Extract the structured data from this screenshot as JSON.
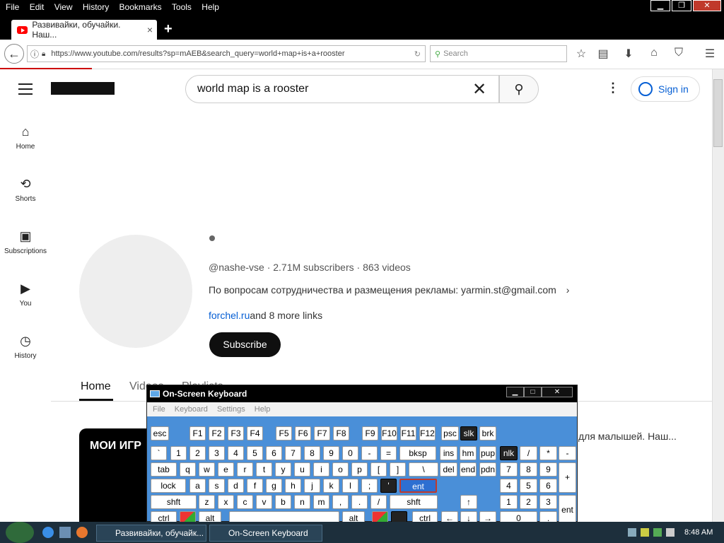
{
  "menubar": {
    "items": [
      "File",
      "Edit",
      "View",
      "History",
      "Bookmarks",
      "Tools",
      "Help"
    ]
  },
  "tab": {
    "title": "Развивайки, обучайки. Наш...",
    "close": "×",
    "new": "+"
  },
  "nav": {
    "url": "https://www.youtube.com/results?sp=mAEB&search_query=world+map+is+a+rooster",
    "search_placeholder": "Search"
  },
  "youtube": {
    "search_value": "world map is a rooster",
    "sign_in": "Sign in",
    "sidebar": [
      {
        "label": "Home",
        "icon": "home-icon"
      },
      {
        "label": "Shorts",
        "icon": "shorts-icon"
      },
      {
        "label": "Subscriptions",
        "icon": "subscriptions-icon"
      },
      {
        "label": "You",
        "icon": "you-icon"
      },
      {
        "label": "History",
        "icon": "history-icon"
      }
    ],
    "channel": {
      "handle": "@nashe-vse · 2.71M subscribers · 863 videos",
      "description": "По вопросам сотрудничества и размещения рекламы: yarmin.st@gmail.com",
      "link": "forchel.ru",
      "more_links": "and 8 more links",
      "subscribe": "Subscribe"
    },
    "tabs": [
      "Home",
      "Videos",
      "Playlists"
    ],
    "video_card_text": "МОИ ИГР",
    "video_title_partial": "для малышей. Наш..."
  },
  "osk": {
    "title": "On-Screen Keyboard",
    "menu": [
      "File",
      "Keyboard",
      "Settings",
      "Help"
    ],
    "rows": [
      [
        "esc",
        "F1",
        "F2",
        "F3",
        "F4",
        "F5",
        "F6",
        "F7",
        "F8",
        "F9",
        "F10",
        "F11",
        "F12",
        "psc",
        "slk",
        "brk"
      ],
      [
        "`",
        "1",
        "2",
        "3",
        "4",
        "5",
        "6",
        "7",
        "8",
        "9",
        "0",
        "-",
        "=",
        "bksp",
        "ins",
        "hm",
        "pup",
        "nlk",
        "/",
        "*",
        "-"
      ],
      [
        "tab",
        "q",
        "w",
        "e",
        "r",
        "t",
        "y",
        "u",
        "i",
        "o",
        "p",
        "[",
        "]",
        "\\",
        "del",
        "end",
        "pdn",
        "7",
        "8",
        "9",
        "+"
      ],
      [
        "lock",
        "a",
        "s",
        "d",
        "f",
        "g",
        "h",
        "j",
        "k",
        "l",
        ";",
        "'",
        "ent",
        "4",
        "5",
        "6"
      ],
      [
        "shft",
        "z",
        "x",
        "c",
        "v",
        "b",
        "n",
        "m",
        ",",
        ".",
        "/",
        "shft",
        "↑",
        "1",
        "2",
        "3",
        "ent"
      ],
      [
        "ctrl",
        "alt",
        "alt",
        "ctrl",
        "←",
        "↓",
        "→",
        "0",
        "."
      ]
    ]
  },
  "taskbar": {
    "buttons": [
      "Развивайки, обучайк...",
      "On-Screen Keyboard"
    ],
    "clock": "8:48 AM"
  }
}
